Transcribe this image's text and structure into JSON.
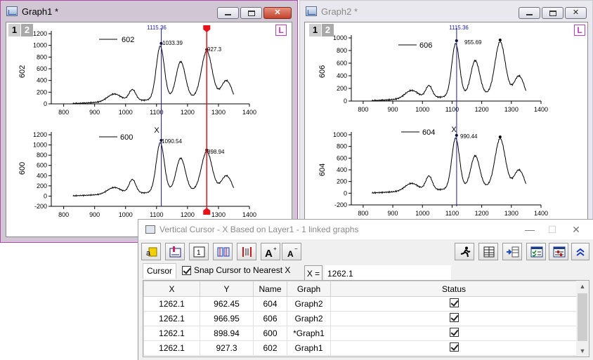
{
  "graph1": {
    "title": "Graph1 *",
    "layer_tabs": [
      "1",
      "2"
    ],
    "l_button": "L",
    "cursor_x_label": "1115.36",
    "top": {
      "legend": "602",
      "ylabel": "602",
      "yticks": [
        "0",
        "200",
        "400",
        "600",
        "800",
        "1000",
        "1200"
      ],
      "ylim": [
        0,
        1200
      ],
      "xticks": [
        "800",
        "900",
        "1000",
        "1100",
        "1200",
        "1300",
        "1400"
      ],
      "annotations": [
        "1033.39",
        "927.3"
      ]
    },
    "bottom": {
      "legend": "600",
      "ylabel": "600",
      "xlabel": "X",
      "yticks": [
        "-200",
        "0",
        "200",
        "400",
        "600",
        "800",
        "1000",
        "1200"
      ],
      "ylim": [
        -200,
        1200
      ],
      "xticks": [
        "800",
        "900",
        "1000",
        "1100",
        "1200",
        "1300",
        "1400"
      ],
      "annotations": [
        "1090.54",
        "898.94"
      ]
    }
  },
  "graph2": {
    "title": "Graph2 *",
    "layer_tabs": [
      "1",
      "2"
    ],
    "l_button": "L",
    "cursor_x_label": "1115.36",
    "top": {
      "legend": "606",
      "ylabel": "606",
      "yticks": [
        "0",
        "200",
        "400",
        "600",
        "800",
        "1000"
      ],
      "ylim": [
        0,
        1000
      ],
      "xticks": [
        "800",
        "900",
        "1000",
        "1100",
        "1200",
        "1300",
        "1400"
      ],
      "annotations": [
        "955.69"
      ]
    },
    "bottom": {
      "legend": "604",
      "ylabel": "604",
      "xlabel": "X",
      "yticks": [
        "-200",
        "0",
        "200",
        "400",
        "600",
        "800",
        "1000"
      ],
      "ylim": [
        -200,
        1000
      ],
      "xticks": [
        "800",
        "900",
        "1000",
        "1100",
        "1200",
        "1300",
        "1400"
      ],
      "annotations": [
        "990.44"
      ]
    }
  },
  "cursor_window": {
    "title": "Vertical Cursor - X Based on Layer1 - 1 linked graphs",
    "x_label": "X =",
    "x_value": "1262.1",
    "tab": "Cursor",
    "snap_label": "Snap Cursor to Nearest X",
    "snap_checked": true,
    "columns": [
      "X",
      "Y",
      "Name",
      "Graph",
      "Status"
    ],
    "rows": [
      {
        "x": "1262.1",
        "y": "962.45",
        "name": "604",
        "graph": "Graph2",
        "status": true
      },
      {
        "x": "1262.1",
        "y": "966.95",
        "name": "606",
        "graph": "Graph2",
        "status": true
      },
      {
        "x": "1262.1",
        "y": "898.94",
        "name": "600",
        "graph": "*Graph1",
        "status": true
      },
      {
        "x": "1262.1",
        "y": "927.3",
        "name": "602",
        "graph": "Graph1",
        "status": true
      }
    ]
  },
  "colors": {
    "graph1_border": "#b04aa8",
    "cursor_blue": "#1a1aa8",
    "cursor_red": "#e8121a",
    "l_button": "#c03cbf"
  },
  "chart_data": [
    {
      "type": "line",
      "series": [
        {
          "name": "602",
          "x": [
            830,
            900,
            960,
            1000,
            1020,
            1040,
            1080,
            1100,
            1115,
            1130,
            1150,
            1180,
            1200,
            1240,
            1262,
            1290,
            1320,
            1350
          ],
          "y": [
            0,
            30,
            150,
            130,
            250,
            160,
            300,
            700,
            1033,
            700,
            550,
            780,
            700,
            900,
            927,
            400,
            450,
            280
          ]
        }
      ],
      "xlim": [
        760,
        1400
      ],
      "ylim": [
        0,
        1200
      ]
    },
    {
      "type": "line",
      "series": [
        {
          "name": "600",
          "x": [
            830,
            900,
            960,
            1000,
            1020,
            1040,
            1080,
            1100,
            1115,
            1130,
            1150,
            1180,
            1200,
            1240,
            1262,
            1290,
            1320,
            1350
          ],
          "y": [
            0,
            30,
            160,
            150,
            330,
            200,
            330,
            750,
            1090,
            720,
            560,
            800,
            650,
            880,
            899,
            380,
            430,
            260
          ]
        }
      ],
      "xlim": [
        760,
        1400
      ],
      "ylim": [
        -200,
        1200
      ]
    },
    {
      "type": "line",
      "series": [
        {
          "name": "606",
          "x": [
            830,
            900,
            960,
            1000,
            1020,
            1040,
            1080,
            1100,
            1115,
            1130,
            1150,
            1180,
            1200,
            1240,
            1262,
            1290,
            1320,
            1350
          ],
          "y": [
            0,
            30,
            150,
            120,
            250,
            150,
            300,
            650,
            956,
            620,
            470,
            700,
            600,
            900,
            967,
            450,
            470,
            260
          ]
        }
      ],
      "xlim": [
        760,
        1400
      ],
      "ylim": [
        0,
        1000
      ]
    },
    {
      "type": "line",
      "series": [
        {
          "name": "604",
          "x": [
            830,
            900,
            960,
            1000,
            1020,
            1040,
            1080,
            1100,
            1115,
            1130,
            1150,
            1180,
            1200,
            1240,
            1262,
            1290,
            1320,
            1350
          ],
          "y": [
            0,
            20,
            160,
            130,
            300,
            180,
            310,
            680,
            990,
            620,
            450,
            700,
            580,
            900,
            962,
            440,
            430,
            230
          ]
        }
      ],
      "xlim": [
        760,
        1400
      ],
      "ylim": [
        -200,
        1000
      ]
    }
  ]
}
